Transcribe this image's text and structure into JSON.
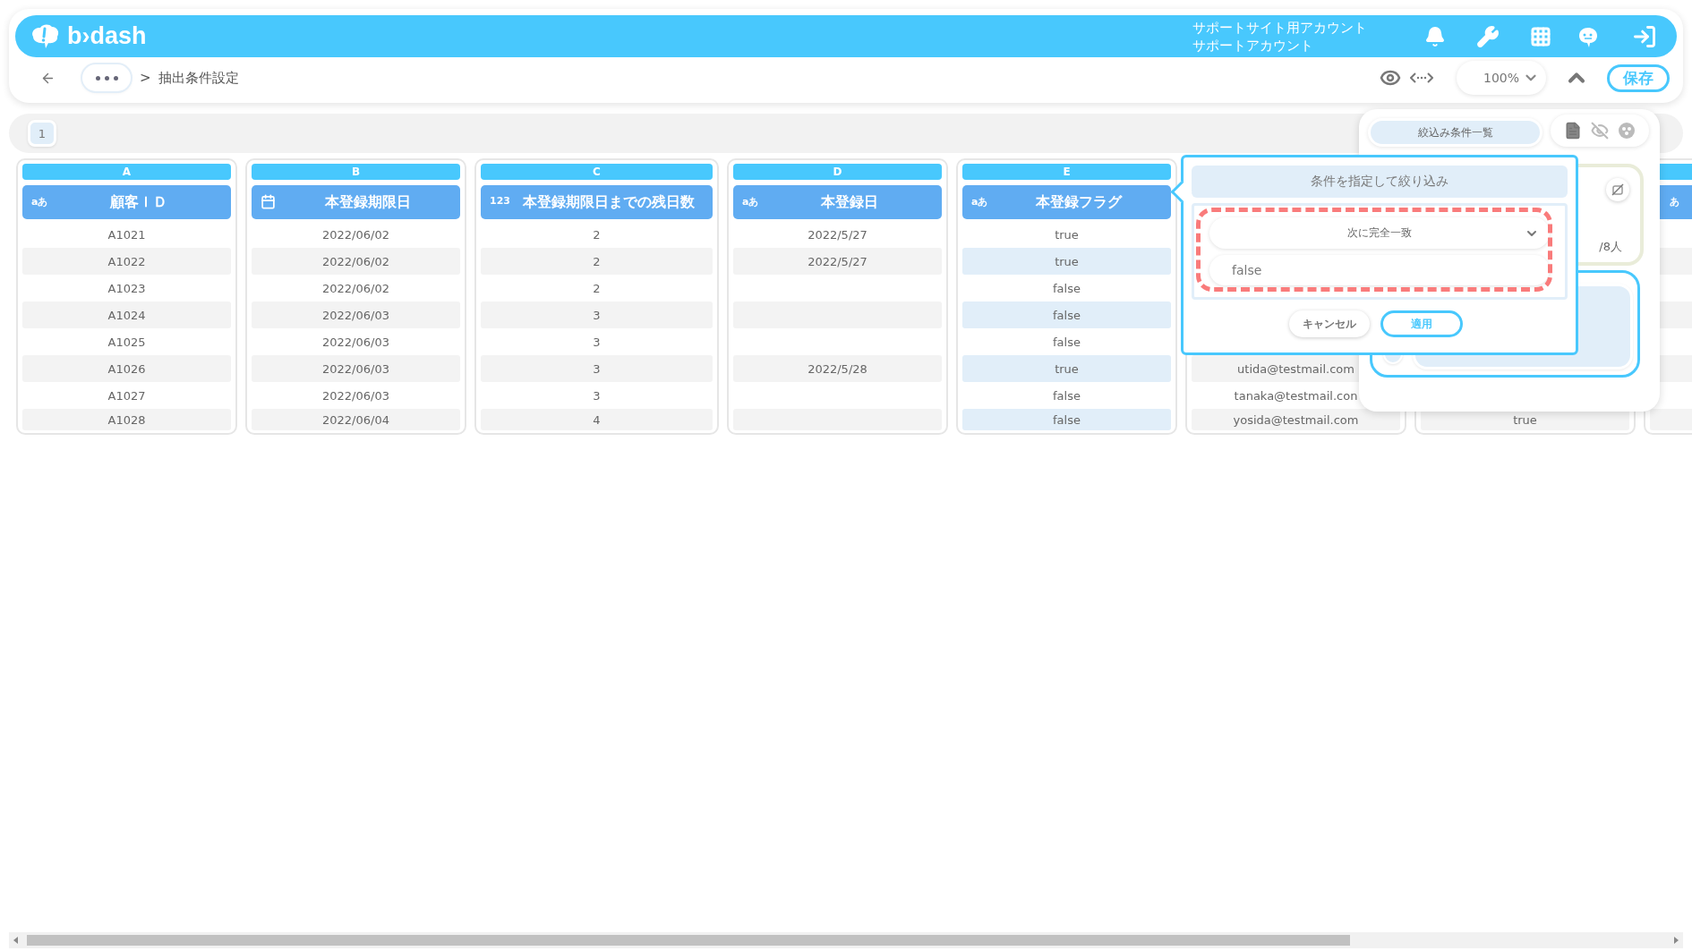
{
  "header": {
    "logo": "b›dash",
    "account_lines": [
      "サポートサイト用アカウント",
      "サポートアカウント"
    ]
  },
  "toolbar": {
    "separator": ">",
    "breadcrumb": "抽出条件設定",
    "zoom": "100%",
    "save": "保存"
  },
  "page_tabs": [
    {
      "label": "1",
      "selected": true
    }
  ],
  "columns": [
    {
      "letter": "A",
      "title": "顧客ＩＤ",
      "kind": "text",
      "badge": "aあ",
      "cells": [
        "A1021",
        "A1022",
        "A1023",
        "A1024",
        "A1025",
        "A1026",
        "A1027",
        "A1028"
      ]
    },
    {
      "letter": "B",
      "title": "本登録期限日",
      "kind": "date",
      "cells": [
        "2022/06/02",
        "2022/06/02",
        "2022/06/02",
        "2022/06/03",
        "2022/06/03",
        "2022/06/03",
        "2022/06/03",
        "2022/06/04"
      ]
    },
    {
      "letter": "C",
      "title": "本登録期限日までの残日数",
      "kind": "number",
      "badge": "123",
      "cells": [
        "2",
        "2",
        "2",
        "3",
        "3",
        "3",
        "3",
        "4"
      ]
    },
    {
      "letter": "D",
      "title": "本登録日",
      "kind": "text",
      "badge": "aあ",
      "cells": [
        "2022/5/27",
        "2022/5/27",
        null,
        null,
        null,
        "2022/5/28",
        null,
        null
      ]
    },
    {
      "letter": "E",
      "title": "本登録フラグ",
      "kind": "text",
      "badge": "aあ",
      "highlighted": true,
      "cells": [
        "true",
        "true",
        "false",
        "false",
        "false",
        "true",
        "false",
        "false"
      ]
    },
    {
      "kind": "hidden",
      "cells": [
        null,
        null,
        null,
        null,
        null,
        "utida@testmail.com",
        "tanaka@testmail.con",
        "yosida@testmail.com"
      ]
    },
    {
      "kind": "hidden",
      "cells": [
        null,
        null,
        null,
        null,
        null,
        null,
        null,
        "true"
      ]
    },
    {
      "kind": "text",
      "badge": "あ"
    }
  ],
  "filter_panel": {
    "title": "絞込み条件一覧",
    "count": "/8人"
  },
  "filter_popup": {
    "title": "条件を指定して絞り込み",
    "operator": "次に完全一致",
    "value": "false",
    "highlighted": true,
    "buttons": [
      {
        "label": "キャンセル",
        "primary": false
      },
      {
        "label": "適用",
        "primary": true
      }
    ]
  }
}
